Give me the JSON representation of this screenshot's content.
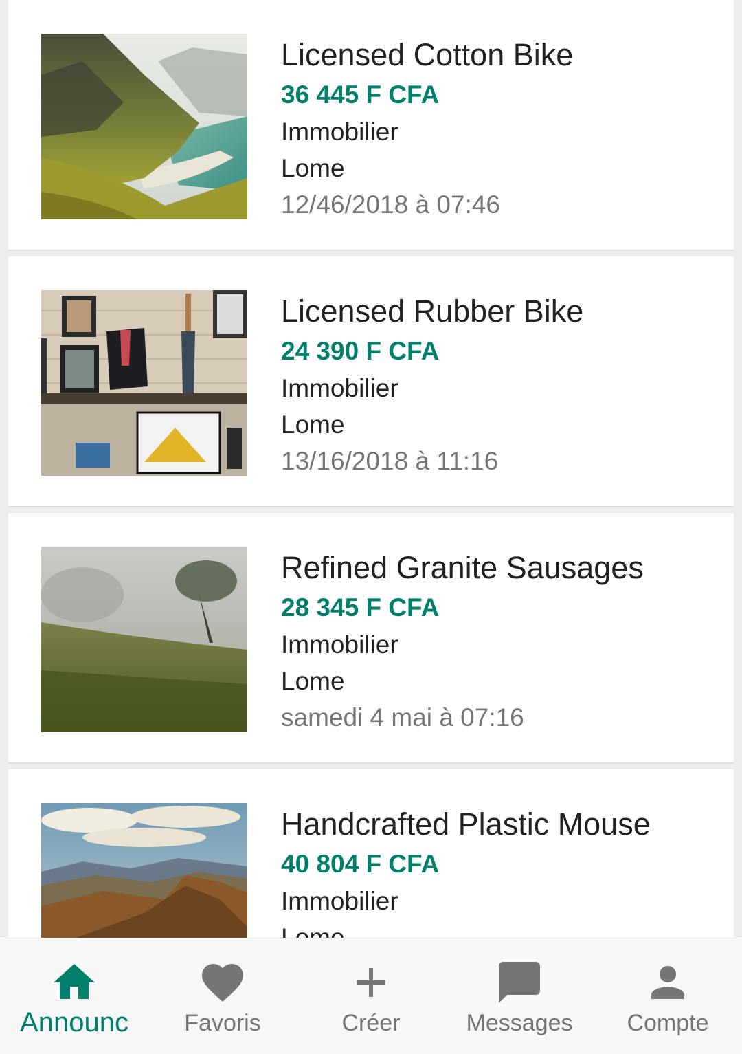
{
  "listings": [
    {
      "title": "Licensed Cotton Bike",
      "price": "36 445 F CFA",
      "category": "Immobilier",
      "location": "Lome",
      "date": "12/46/2018 à 07:46",
      "image": "coastal-cliff-photo"
    },
    {
      "title": "Licensed Rubber Bike",
      "price": "24 390 F CFA",
      "category": "Immobilier",
      "location": "Lome",
      "date": "13/16/2018 à 11:16",
      "image": "shop-interior-photo"
    },
    {
      "title": "Refined Granite Sausages",
      "price": "28 345 F CFA",
      "category": "Immobilier",
      "location": "Lome",
      "date": "samedi 4 mai à 07:16",
      "image": "foggy-meadow-photo"
    },
    {
      "title": "Handcrafted Plastic Mouse",
      "price": "40 804 F CFA",
      "category": "Immobilier",
      "location": "Lome",
      "date": "",
      "image": "mountain-ridge-photo"
    }
  ],
  "bottom_nav": [
    {
      "label": "Announc",
      "icon": "home-icon",
      "active": true
    },
    {
      "label": "Favoris",
      "icon": "heart-icon",
      "active": false
    },
    {
      "label": "Créer",
      "icon": "plus-icon",
      "active": false
    },
    {
      "label": "Messages",
      "icon": "message-icon",
      "active": false
    },
    {
      "label": "Compte",
      "icon": "person-icon",
      "active": false
    }
  ],
  "colors": {
    "accent": "#00806b",
    "inactive": "#757575",
    "background": "#ededed"
  }
}
